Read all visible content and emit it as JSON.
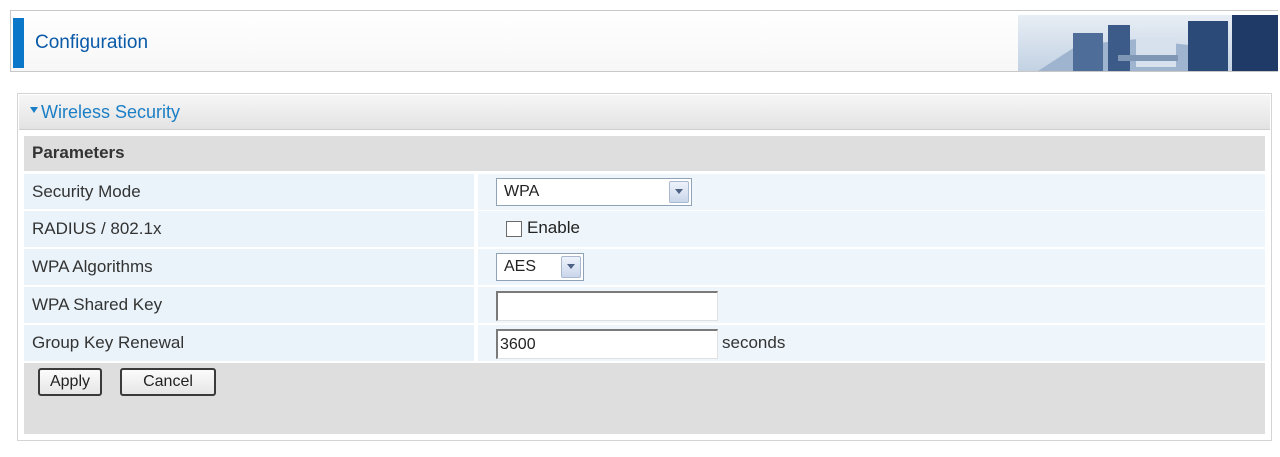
{
  "header": {
    "title": "Configuration"
  },
  "section": {
    "title": "Wireless Security",
    "params_label": "Parameters"
  },
  "fields": {
    "security_mode": {
      "label": "Security Mode",
      "value": "WPA"
    },
    "radius": {
      "label": "RADIUS / 802.1x",
      "checkbox_label": "Enable",
      "checked": false
    },
    "wpa_algorithms": {
      "label": "WPA Algorithms",
      "value": "AES"
    },
    "wpa_shared_key": {
      "label": "WPA Shared Key",
      "value": ""
    },
    "group_key_renewal": {
      "label": "Group Key Renewal",
      "value": "3600",
      "unit": "seconds"
    }
  },
  "buttons": {
    "apply": "Apply",
    "cancel": "Cancel"
  },
  "colors": {
    "accent": "#0a77c8",
    "section_title": "#1b7fc6",
    "row_bg": "#e9f3f9"
  }
}
